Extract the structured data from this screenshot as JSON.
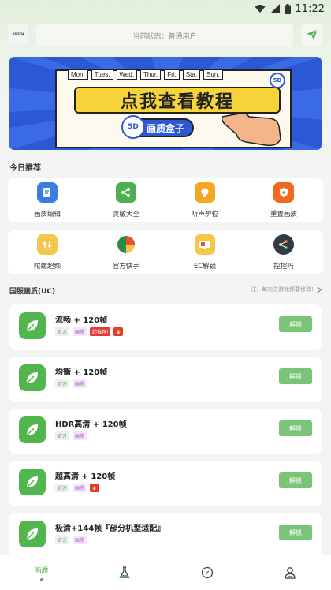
{
  "status_bar": {
    "time": "11:22"
  },
  "header": {
    "logo_text": "SSDTH",
    "status_text": "当前状态：普通用户"
  },
  "banner": {
    "days": [
      "Mon.",
      "Tues.",
      "Wed.",
      "Thur.",
      "Fri.",
      "Sta.",
      "Sun."
    ],
    "headline": "点我查看教程",
    "subline": "画质盒子",
    "badge": "5D"
  },
  "today": {
    "title": "今日推荐",
    "row1": [
      {
        "label": "画质编辑",
        "icon": "edit-icon",
        "color": "#3b7de0"
      },
      {
        "label": "灵敏大全",
        "icon": "share-icon",
        "color": "#4caf50"
      },
      {
        "label": "听声辨位",
        "icon": "bulb-icon",
        "color": "#f5a623"
      },
      {
        "label": "重置画质",
        "icon": "shield-icon",
        "color": "#f06a1e"
      }
    ],
    "row2": [
      {
        "label": "陀螺超频",
        "icon": "sliders-icon",
        "color": "#f4c64d"
      },
      {
        "label": "官方快手",
        "icon": "pie-icon",
        "color": "#e94f35"
      },
      {
        "label": "EC解锁",
        "icon": "monitor-icon",
        "color": "#f6c646"
      },
      {
        "label": "控控吗",
        "icon": "nodes-icon",
        "color": "#2f3b4a"
      }
    ]
  },
  "presets_section": {
    "title": "国服画质(UC)",
    "note": "注：每次进游戏都要修改!"
  },
  "presets": [
    {
      "name": "流畅 + 120帧",
      "tags": [
        "官方",
        "画质",
        "超推荐!",
        "🔥"
      ],
      "button": "解锁"
    },
    {
      "name": "均衡 + 120帧",
      "tags": [
        "官方",
        "画质"
      ],
      "button": "解锁"
    },
    {
      "name": "HDR高清 + 120帧",
      "tags": [
        "官方",
        "画质"
      ],
      "button": "解锁"
    },
    {
      "name": "超高清 + 120帧",
      "tags": [
        "官方",
        "画质",
        "🔥"
      ],
      "button": "解锁"
    },
    {
      "name": "极清+144帧『部分机型适配』",
      "tags": [
        "官方",
        "画质"
      ],
      "button": "解锁"
    }
  ],
  "bottom_nav": [
    {
      "label": "画质",
      "icon": "home-icon",
      "active": true
    },
    {
      "label": "",
      "icon": "flask-icon",
      "active": false
    },
    {
      "label": "",
      "icon": "compass-icon",
      "active": false
    },
    {
      "label": "",
      "icon": "user-icon",
      "active": false
    }
  ],
  "colors": {
    "accent": "#55b052",
    "button": "#7ac477",
    "banner": "#2c58d6"
  }
}
